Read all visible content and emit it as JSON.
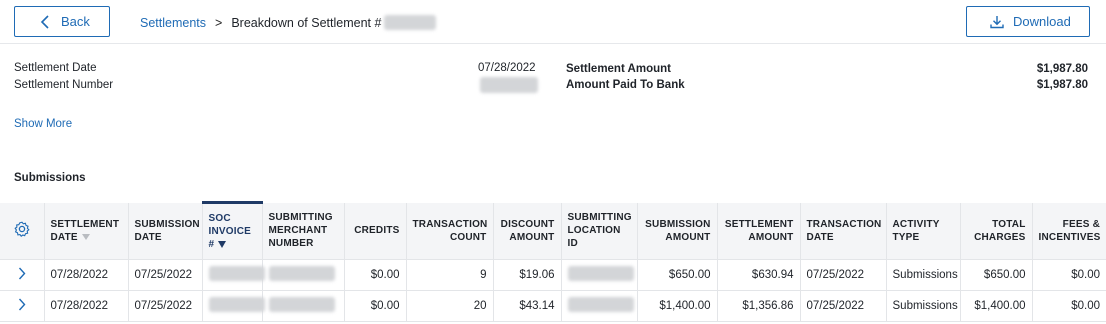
{
  "toolbar": {
    "back_label": "Back",
    "download_label": "Download"
  },
  "breadcrumb": {
    "parent": "Settlements",
    "separator": ">",
    "current": "Breakdown of Settlement #"
  },
  "summary": {
    "settlement_date_label": "Settlement Date",
    "settlement_date_value": "07/28/2022",
    "settlement_number_label": "Settlement Number",
    "settlement_amount_label": "Settlement Amount",
    "settlement_amount_value": "$1,987.80",
    "paid_to_bank_label": "Amount Paid To Bank",
    "paid_to_bank_value": "$1,987.80",
    "show_more": "Show More"
  },
  "submissions": {
    "title": "Submissions",
    "columns": {
      "settlement_date": "Settlement Date",
      "submission_date": "Submission Date",
      "soc_invoice": "SOC Invoice #",
      "submitting_merchant_number": "Submitting Merchant Number",
      "credits": "Credits",
      "transaction_count": "Transaction Count",
      "discount_amount": "Discount Amount",
      "submitting_location_id": "Submitting Location ID",
      "submission_amount": "Submission Amount",
      "settlement_amount": "Settlement Amount",
      "transaction_date": "Transaction Date",
      "activity_type": "Activity Type",
      "total_charges": "Total Charges",
      "fees_incentives": "Fees & Incentives"
    },
    "rows": [
      {
        "settlement_date": "07/28/2022",
        "submission_date": "07/25/2022",
        "credits": "$0.00",
        "transaction_count": "9",
        "discount_amount": "$19.06",
        "submission_amount": "$650.00",
        "settlement_amount": "$630.94",
        "transaction_date": "07/25/2022",
        "activity_type": "Submissions",
        "total_charges": "$650.00",
        "fees_incentives": "$0.00"
      },
      {
        "settlement_date": "07/28/2022",
        "submission_date": "07/25/2022",
        "credits": "$0.00",
        "transaction_count": "20",
        "discount_amount": "$43.14",
        "submission_amount": "$1,400.00",
        "settlement_amount": "$1,356.86",
        "transaction_date": "07/25/2022",
        "activity_type": "Submissions",
        "total_charges": "$1,400.00",
        "fees_incentives": "$0.00"
      }
    ]
  },
  "icons": {
    "back": "chevron-left-icon",
    "download": "download-icon",
    "settings": "gear-icon",
    "expand": "chevron-right-icon"
  },
  "colors": {
    "accent": "#1f6bb5",
    "active_sort": "#1f3a66",
    "header_bg": "#f4f5f7"
  }
}
